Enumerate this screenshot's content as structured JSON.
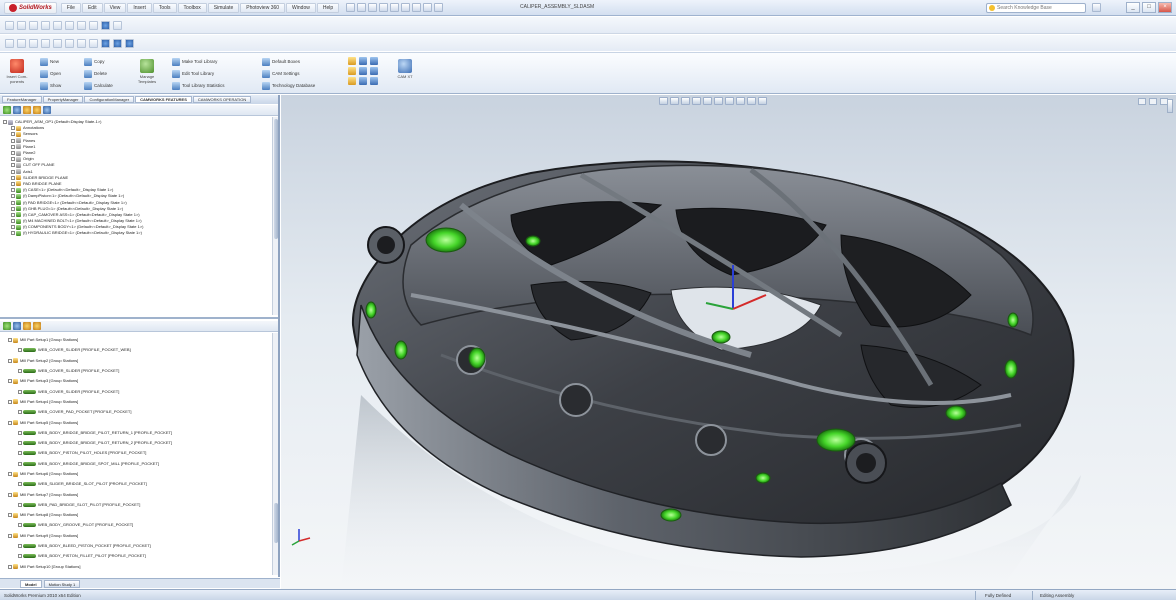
{
  "app": {
    "logo_text": "SolidWorks",
    "menu": [
      "File",
      "Edit",
      "View",
      "Insert",
      "Tools",
      "Toolbox",
      "Simulate",
      "Photoview 360",
      "Window",
      "Help"
    ],
    "doc_title": "CALIPER_ASSEMBLY_SLDASM",
    "search_placeholder": "Search Knowledge Base",
    "window_buttons": [
      "_",
      "□",
      "×"
    ]
  },
  "ribbon": {
    "buttons": {
      "big1": "Insert Com-ponents",
      "b_new": "New",
      "b_open": "Open",
      "b_show": "Show",
      "b_copy": "Copy",
      "b_delete": "Delete",
      "b_calc": "Calculate",
      "big2": "Manage Templates",
      "b_make": "Make Tool Library",
      "b_edit": "Edit Tool Library",
      "b_tool": "Tool Library Statistics",
      "b_default": "Default Boxes",
      "b_check": "CAM Settings",
      "b_tech": "Technology Database",
      "big3": "CAM XT"
    }
  },
  "left_panel": {
    "tabs": [
      "FeatureManager",
      "PropertyManager",
      "ConfigurationManager",
      "CAMWORKS FEATURES",
      "CAMWORKS OPERATION"
    ],
    "active_tab": "CAMWORKS FEATURES",
    "top_tree": [
      {
        "label": "CALIPER_ASM_OP1 (Default<Display State-1>)",
        "icon": "assembly"
      },
      {
        "label": "Annotations",
        "icon": "folder"
      },
      {
        "label": "Sensors",
        "icon": "folder"
      },
      {
        "label": "Planes",
        "icon": "plane"
      },
      {
        "label": "Plane1",
        "icon": "plane"
      },
      {
        "label": "Plane2",
        "icon": "plane"
      },
      {
        "label": "Origin",
        "icon": "plane"
      },
      {
        "label": "CUT OFF PLANE",
        "icon": "plane"
      },
      {
        "label": "Axis1",
        "icon": "plane"
      },
      {
        "label": "SLIDER BRIDGE PLANE",
        "icon": "folder"
      },
      {
        "label": "PAD BRIDGE PLANE",
        "icon": "folder"
      },
      {
        "label": "(f) CASE<1> (Default<<Default>_Display State 1>)",
        "icon": "part"
      },
      {
        "label": "(f) DampPiston<1> (Default<<Default>_Display State 1>)",
        "icon": "part"
      },
      {
        "label": "(f) PAD BRIDGE<1> (Default<<Default>_Display State 1>)",
        "icon": "part"
      },
      {
        "label": "(f) GHB PLUG<1> (Default<<Default>_Display State 1>)",
        "icon": "part"
      },
      {
        "label": "(f) CAP_CAMOVER ASS<1> (Default<Default>_Display State 1>)",
        "icon": "part"
      },
      {
        "label": "(f) M4 MACHINED BOLT<1> (Default<<Default>_Display State 1>)",
        "icon": "part"
      },
      {
        "label": "(f) COMPONENTS BODY<1> (Default<<Default>_Display State 1>)",
        "icon": "part"
      },
      {
        "label": "(f) HYDRAULIC BRIDGE<1> (Default<<Default>_Display State 1>)",
        "icon": "part"
      }
    ],
    "bottom_tree": [
      {
        "label": "Mill Part Setup1 [Group Stations]",
        "level": 0,
        "kind": "group"
      },
      {
        "label": "WEB_COVER_SLIDER [PROFILE_POCKET_WEB]",
        "level": 1,
        "kind": "op"
      },
      {
        "label": "Mill Part Setup2 [Group Stations]",
        "level": 0,
        "kind": "group"
      },
      {
        "label": "WEB_COVER_SLIDER [PROFILE_POCKET]",
        "level": 1,
        "kind": "op"
      },
      {
        "label": "Mill Part Setup3 [Group Stations]",
        "level": 0,
        "kind": "group"
      },
      {
        "label": "WEB_COVER_SLIDER [PROFILE_POCKET]",
        "level": 1,
        "kind": "op"
      },
      {
        "label": "Mill Part Setup4 [Group Stations]",
        "level": 0,
        "kind": "group"
      },
      {
        "label": "WEB_COVER_PAD_POCKET [PROFILE_POCKET]",
        "level": 1,
        "kind": "op"
      },
      {
        "label": "Mill Part Setup5 [Group Stations]",
        "level": 0,
        "kind": "group"
      },
      {
        "label": "WEB_BODY_BRIDGE_BRIDGE_PILOT_RETURN_1 [PROFILE_POCKET]",
        "level": 1,
        "kind": "op"
      },
      {
        "label": "WEB_BODY_BRIDGE_BRIDGE_PILOT_RETURN_2 [PROFILE_POCKET]",
        "level": 1,
        "kind": "op"
      },
      {
        "label": "WEB_BODY_PISTON_PILOT_HOLES [PROFILE_POCKET]",
        "level": 1,
        "kind": "op"
      },
      {
        "label": "WEB_BODY_BRIDGE_BRIDGE_SPOT_MILL [PROFILE_POCKET]",
        "level": 1,
        "kind": "op"
      },
      {
        "label": "Mill Part Setup6 [Group Stations]",
        "level": 0,
        "kind": "group"
      },
      {
        "label": "WEB_SLIDER_BRIDGE_SLOT_PILOT [PROFILE_POCKET]",
        "level": 1,
        "kind": "op"
      },
      {
        "label": "Mill Part Setup7 [Group Stations]",
        "level": 0,
        "kind": "group"
      },
      {
        "label": "WEB_PAD_BRIDGE_SLOT_PILOT [PROFILE_POCKET]",
        "level": 1,
        "kind": "op"
      },
      {
        "label": "Mill Part Setup8 [Group Stations]",
        "level": 0,
        "kind": "group"
      },
      {
        "label": "WEB_BODY_GROOVE_PILOT [PROFILE_POCKET]",
        "level": 1,
        "kind": "op"
      },
      {
        "label": "Mill Part Setup9 [Group Stations]",
        "level": 0,
        "kind": "group"
      },
      {
        "label": "WEB_BODY_BLEED_PISTON_POCKET [PROFILE_POCKET]",
        "level": 1,
        "kind": "op"
      },
      {
        "label": "WEB_BODY_PISTON_FILLET_PILOT [PROFILE_POCKET]",
        "level": 1,
        "kind": "op"
      },
      {
        "label": "Mill Part Setup10 [Group Stations]",
        "level": 0,
        "kind": "group"
      }
    ],
    "bottom_tabs": [
      "Model",
      "Motion Study 1"
    ],
    "active_bottom_tab": "Model"
  },
  "status": {
    "left": "SolidWorks Premium 2010 x64 Edition",
    "mid": "Fully Defined",
    "right": "Editing Assembly"
  },
  "colors": {
    "accent_green": "#55e03a",
    "model_dark": "#3a3d42",
    "viewport_top": "#c9d3df"
  }
}
